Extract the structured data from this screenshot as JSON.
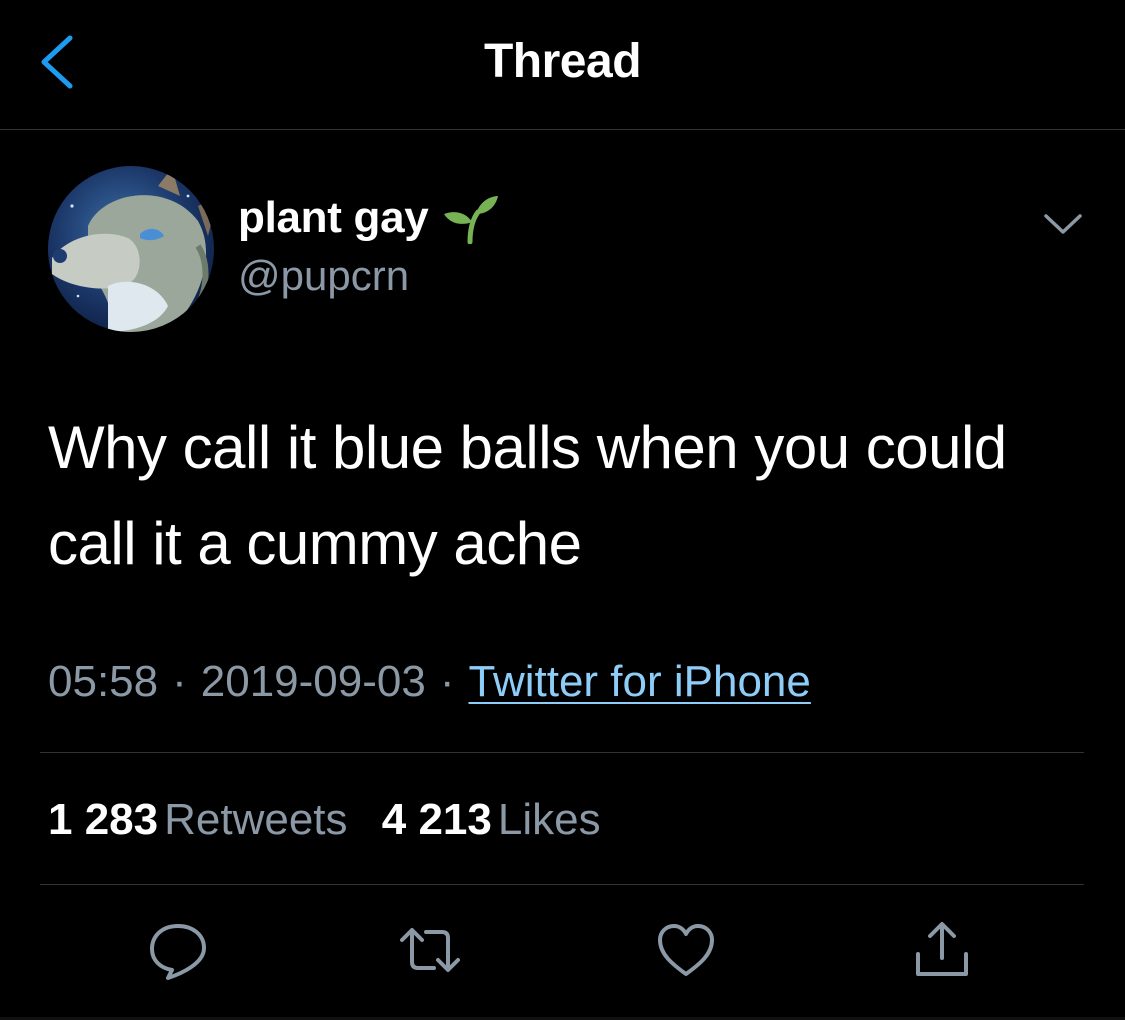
{
  "header": {
    "title": "Thread",
    "back_icon": "chevron-left-icon"
  },
  "tweet": {
    "author": {
      "display_name": "plant gay",
      "name_emoji": "seedling-icon",
      "handle": "@pupcrn"
    },
    "text": "Why call it blue balls when you could call it a cummy ache",
    "time": "05:58",
    "date": "2019-09-03",
    "separator": "·",
    "source": "Twitter for iPhone"
  },
  "stats": {
    "retweets_count": "1 283",
    "retweets_label": "Retweets",
    "likes_count": "4 213",
    "likes_label": "Likes"
  },
  "actions": [
    "reply-icon",
    "retweet-icon",
    "like-icon",
    "share-icon"
  ],
  "colors": {
    "background": "#000000",
    "text_primary": "#ffffff",
    "text_secondary": "#8b98a5",
    "accent": "#1d9bf0",
    "link": "#8ecdf8",
    "divider": "#2f3336",
    "sprout": "#77b255"
  }
}
